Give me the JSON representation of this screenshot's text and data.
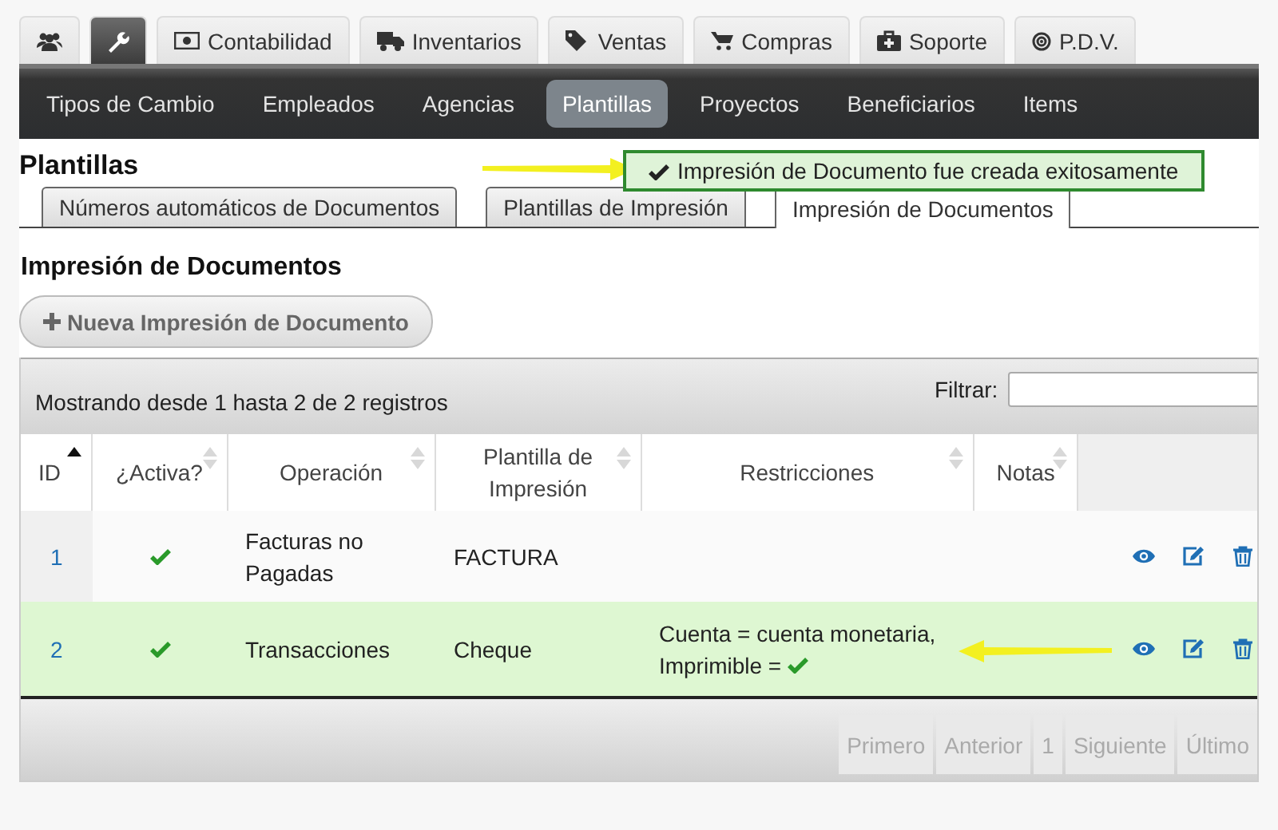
{
  "module_tabs": [
    {
      "selected": false
    },
    {
      "selected": true
    },
    {
      "label": "Contabilidad",
      "selected": false
    },
    {
      "label": "Inventarios",
      "selected": false
    },
    {
      "label": "Ventas",
      "selected": false
    },
    {
      "label": "Compras",
      "selected": false
    },
    {
      "label": "Soporte",
      "selected": false
    },
    {
      "label": "P.D.V.",
      "selected": false
    }
  ],
  "nav": [
    {
      "label": "Tipos de Cambio",
      "selected": false
    },
    {
      "label": "Empleados",
      "selected": false
    },
    {
      "label": "Agencias",
      "selected": false
    },
    {
      "label": "Plantillas",
      "selected": true
    },
    {
      "label": "Proyectos",
      "selected": false
    },
    {
      "label": "Beneficiarios",
      "selected": false
    },
    {
      "label": "Items",
      "selected": false
    }
  ],
  "page_title": "Plantillas",
  "alert": "Impresión de Documento fue creada exitosamente",
  "sub_tabs": [
    {
      "label": "Números automáticos de Documentos",
      "selected": false
    },
    {
      "label": "Plantillas de Impresión",
      "selected": false
    },
    {
      "label": "Impresión de Documentos",
      "selected": true
    }
  ],
  "section_title": "Impresión de Documentos",
  "new_button": "Nueva Impresión de Documento",
  "table": {
    "info": "Mostrando desde 1 hasta 2 de 2 registros",
    "filter_label": "Filtrar:",
    "columns": [
      {
        "label": "ID",
        "sorted": true
      },
      {
        "label": "¿Activa?",
        "sorted": false
      },
      {
        "label": "Operación",
        "sorted": false
      },
      {
        "label": "Plantilla de Impresión",
        "sorted": false
      },
      {
        "label": "Restricciones",
        "sorted": false
      },
      {
        "label": "Notas",
        "sorted": false
      }
    ],
    "rows": [
      {
        "id": "1",
        "active": true,
        "operation": "Facturas no Pagadas",
        "template": "FACTURA",
        "selected": false
      },
      {
        "id": "2",
        "active": true,
        "operation": "Transacciones",
        "template": "Cheque",
        "restrictions": {
          "text": "Cuenta = cuenta monetaria,",
          "printable_label": "Imprimible =",
          "printable": true
        },
        "selected": true
      }
    ],
    "pagination": [
      {
        "label": "Primero",
        "disabled": true
      },
      {
        "label": "Anterior",
        "disabled": true
      },
      {
        "label": "1",
        "disabled": true
      },
      {
        "label": "Siguiente",
        "disabled": true
      },
      {
        "label": "Último",
        "disabled": true
      }
    ]
  }
}
